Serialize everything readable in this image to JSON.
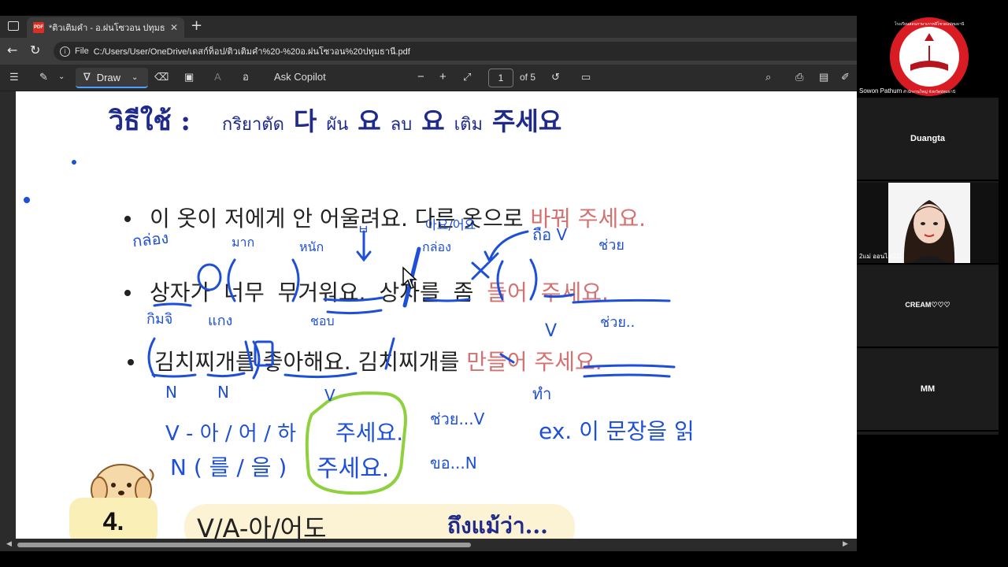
{
  "browser": {
    "tab_title": "*ติวเติมคำ - อ.ฝนโซวอน ปทุมธานี.pdf",
    "tab_badge": "PDF",
    "tab_close": "✕",
    "tab_new": "+",
    "url_label": "File",
    "url": "C:/Users/User/OneDrive/เดสก์ท็อป/ติวเติมคำ%20-%20อ.ฝนโซวอน%20ปทุมธานี.pdf"
  },
  "toolbar": {
    "draw_label": "Draw",
    "read_aloud_label": "อ",
    "ask_copilot_label": "Ask Copilot",
    "zoom_out": "−",
    "zoom_in": "+",
    "page_current": "1",
    "page_total": "of 5"
  },
  "document": {
    "heading": {
      "label": "วิธีใช้ :",
      "p1": "กริยาตัด",
      "k1": "다",
      "p2": "ผัน",
      "k2": "요",
      "p3": "ลบ",
      "k3": "요",
      "p4": "เติม",
      "k4": "주세요"
    },
    "sentences": [
      {
        "plain": "이 옷이 저에게 안 어울려요. 다른 옷으로 ",
        "highlight": "바꿔 주세요."
      },
      {
        "plain": "상자가 너무 무거워요. 상자를 좀 ",
        "highlight": "들어 주세요."
      },
      {
        "plain": "김치찌개를 좋아해요. 김치찌개를 ",
        "highlight": "만들어 주세요."
      }
    ],
    "section_number": "4.",
    "grammar_ko": "V/A-아/어도",
    "grammar_th": "ถึงแม้ว่า..."
  },
  "handwriting": {
    "s2_box": "กล่อง",
    "s2_too": "มาก",
    "s2_heavy": "หนัก",
    "s2_arrow_top": "ㅂ",
    "s2_ayo": "아요/어요",
    "s2_box2": "กล่อง",
    "s2_hold": "ถือ V",
    "s2_help": "ช่วย",
    "s3_kimchi": "กิมจิ",
    "s3_stew": "แกง",
    "s3_like": "ชอบ",
    "s3_help": "ช่วย..",
    "s2_v": "V",
    "s3_n1": "N",
    "s3_n2": "N",
    "s3_v": "V",
    "s3_make": "ทำ",
    "rule_v": "V - 아 / 어 / 하",
    "rule_n": "N ( 를 / 을 )",
    "rule_box1": "주세요.",
    "rule_box2": "주세요.",
    "rule_help": "ช่วย...V",
    "rule_please": "ขอ...N",
    "example": "ex. 이 문장을 읽"
  },
  "participants": [
    {
      "name": "Sowon Pathum",
      "logo_top": "โรงเรียนสอนภาษาเกาหลีโซวอนปทุมธานี",
      "logo_bottom": "สำนักงานใหญ่ จังหวัดปทุมธานี"
    },
    {
      "name": "Duangta"
    },
    {
      "name": "2แม่ ออนไลน์11"
    },
    {
      "name": "CREAM♡♡♡"
    },
    {
      "name": "MM"
    }
  ],
  "colors": {
    "ink_blue": "#1d4fd8",
    "ink_green": "#8ed13d",
    "heading_navy": "#1f2a8c",
    "highlight_red": "#d47171",
    "yellow_box": "#fbefb8"
  }
}
